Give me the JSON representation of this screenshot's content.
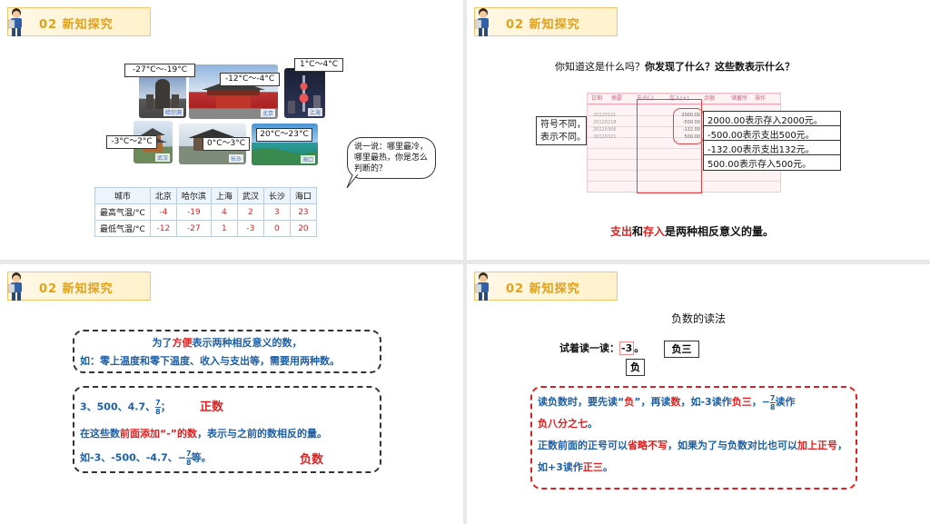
{
  "header": {
    "label": "02  新知探究"
  },
  "slide1": {
    "callouts": {
      "harbin": "-27°C～-19°C",
      "beijing": "-12°C～-4°C",
      "shanghai": "1°C～4°C",
      "wuhan": "-3°C～2°C",
      "changsha": "0°C～3°C",
      "haikou": "20°C～23°C"
    },
    "photo_tags": {
      "harbin": "哈尔滨",
      "beijing": "北京",
      "shanghai": "上海",
      "wuhan": "武汉",
      "changsha": "长沙",
      "haikou": "海口"
    },
    "question": "说一说：哪里最冷，哪里最热，你是怎么判断的？",
    "table": {
      "headers": [
        "城市",
        "北京",
        "哈尔滨",
        "上海",
        "武汉",
        "长沙",
        "海口"
      ],
      "rows": [
        {
          "label": "最高气温/°C",
          "values": [
            "-4",
            "-19",
            "4",
            "2",
            "3",
            "23"
          ]
        },
        {
          "label": "最低气温/°C",
          "values": [
            "-12",
            "-27",
            "1",
            "-3",
            "0",
            "20"
          ]
        }
      ]
    }
  },
  "slide2": {
    "title_a": "你知道这是什么吗？",
    "title_b": "你发现了什么？这些数表示什么？",
    "note_line1": "符号不同，",
    "note_line2": "表示不同。",
    "passbook_headers": [
      "日期",
      "摘要",
      "支出(-)",
      "存入(+)",
      "余额",
      "储蓄所",
      "操作"
    ],
    "passbook_dates": [
      "20120101",
      "20120218",
      "20120306",
      "20120321"
    ],
    "passbook_amounts": [
      "2000.00",
      "-500.00",
      "-132.00",
      "500.00"
    ],
    "explanations": [
      "2000.00表示存入2000元。",
      "-500.00表示支出500元。",
      "-132.00表示支出132元。",
      "500.00表示存入500元。"
    ],
    "conclusion_a": "支出",
    "conclusion_and": "和",
    "conclusion_b": "存入",
    "conclusion_rest": "是两种相反意义的量。"
  },
  "slide3": {
    "box1_l1_a": "为了",
    "box1_l1_b": "方便",
    "box1_l1_c": "表示两种相反意义的数，",
    "box1_l2": "如：零上温度和零下温度、收入与支出等，需要用两种数。",
    "box2_nums": "3、500、4.7、",
    "box2_frac_num": "7",
    "box2_frac_den": "8",
    "box2_semicolon": "；",
    "positive_label": "正数",
    "box2_l2_a": "在这些数",
    "box2_l2_b": "前面添加“-”的数",
    "box2_l2_c": "，表示与之前的数相反的量。",
    "box2_l3_a": "如-3、-500、-4.7、−",
    "box2_l3_frac_num": "7",
    "box2_l3_frac_den": "8",
    "box2_l3_b": "等。",
    "negative_label": "负数"
  },
  "slide4": {
    "title": "负数的读法",
    "try_label": "试着读一读：",
    "try_value": "-3",
    "try_period": "。",
    "answer_box": "负三",
    "sign_label": "负",
    "p1_a": "读负数时，要先读“",
    "p1_b": "负",
    "p1_c": "”，再读",
    "p1_d": "数",
    "p1_e": "，如-3读作",
    "p1_f": "负三",
    "p1_g": "，−",
    "p1_frac_num": "7",
    "p1_frac_den": "8",
    "p1_h": "读作",
    "p1_i": "负八分之七",
    "p1_j": "。",
    "p2_a": "正数前面的正号可以",
    "p2_b": "省略不写",
    "p2_c": "，如果为了与负数对比也可以",
    "p2_d": "加上正号",
    "p2_e": "，如+3读作",
    "p2_f": "正三",
    "p2_g": "。"
  }
}
